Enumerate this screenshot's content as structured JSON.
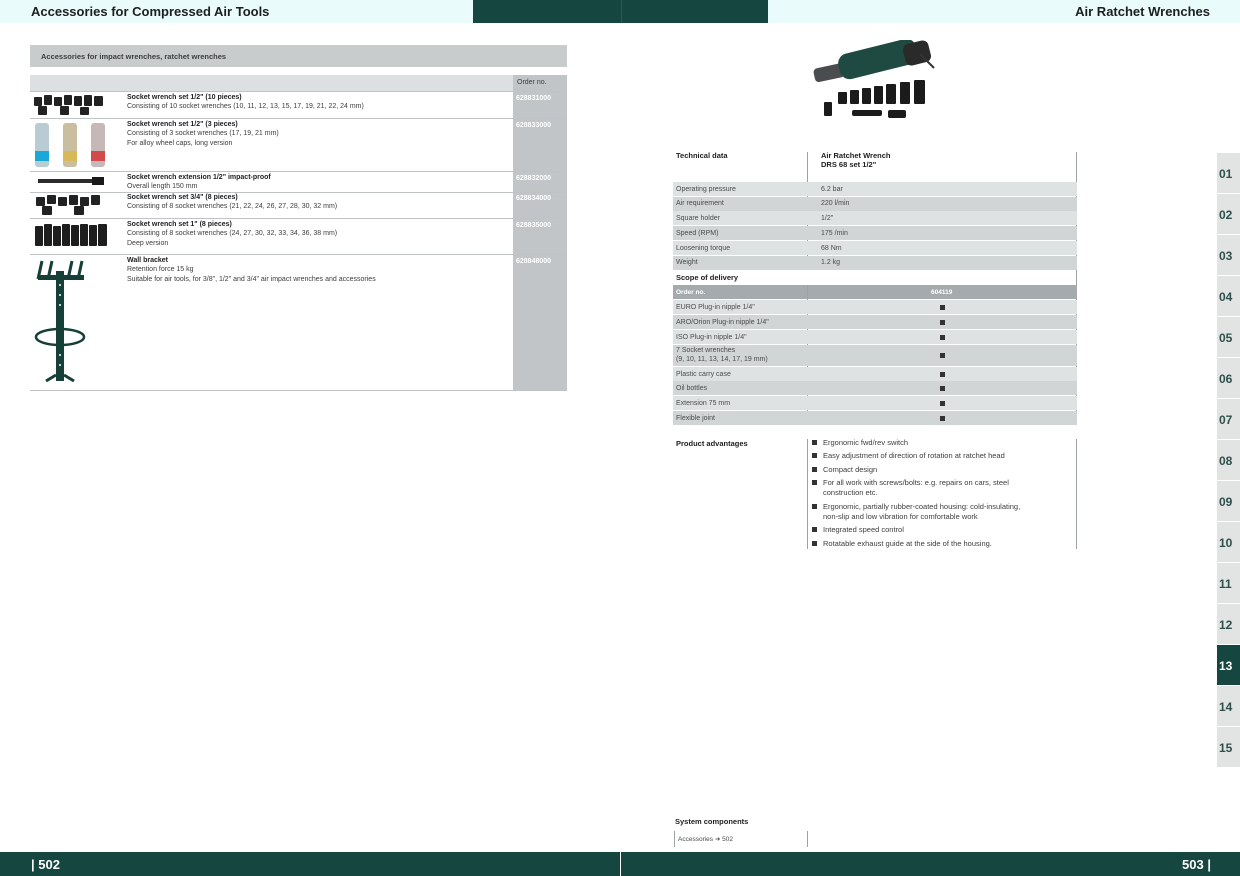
{
  "header": {
    "left_title": "Accessories for Compressed Air Tools",
    "right_title": "Air Ratchet Wrenches"
  },
  "footer": {
    "left_page": "| 502",
    "right_page": "503 |"
  },
  "accessories": {
    "section_title": "Accessories for impact wrenches, ratchet wrenches",
    "order_header": "Order no.",
    "rows": [
      {
        "title": "Socket wrench set 1/2\" (10 pieces)",
        "desc": [
          "Consisting of 10 socket wrenches (10, 11, 12, 13, 15, 17, 19, 21, 22, 24 mm)"
        ],
        "order": "628831000"
      },
      {
        "title": "Socket wrench set 1/2\" (3 pieces)",
        "desc": [
          "Consisting of 3 socket wrenches (17, 19, 21 mm)",
          "For alloy wheel caps, long version"
        ],
        "order": "628833000"
      },
      {
        "title": "Socket wrench extension 1/2\" impact-proof",
        "desc": [
          "Overall length 150 mm"
        ],
        "order": "628832000"
      },
      {
        "title": "Socket wrench set 3/4\" (8 pieces)",
        "desc": [
          "Consisting of 8 socket wrenches (21, 22, 24, 26, 27, 28, 30, 32 mm)"
        ],
        "order": "628834000"
      },
      {
        "title": "Socket wrench set 1\" (8 pieces)",
        "desc": [
          "Consisting of 8 socket wrenches (24, 27, 30, 32, 33, 34, 36, 38 mm)",
          "Deep version"
        ],
        "order": "628835000"
      },
      {
        "title": "Wall bracket",
        "desc": [
          "Retention force 15 kg",
          "Suitable for air tools, for 3/8\", 1/2\" and 3/4\" air impact wrenches and accessories"
        ],
        "order": "628848000"
      }
    ]
  },
  "technical": {
    "heading": "Technical data",
    "product_line1": "Air Ratchet Wrench",
    "product_line2": "DRS 68 set 1/2\"",
    "specs": [
      {
        "label": "Operating pressure",
        "value": "6.2 bar"
      },
      {
        "label": "Air requirement",
        "value": "220 l/min"
      },
      {
        "label": "Square holder",
        "value": "1/2\""
      },
      {
        "label": "Speed (RPM)",
        "value": "175 /min"
      },
      {
        "label": "Loosening torque",
        "value": "68 Nm"
      },
      {
        "label": "Weight",
        "value": "1.2 kg"
      }
    ]
  },
  "scope": {
    "heading": "Scope of delivery",
    "order_label": "Order no.",
    "order_number": "604119",
    "items": [
      {
        "label": "EURO Plug-in nipple 1/4\""
      },
      {
        "label": "ARO/Orion Plug-in nipple 1/4\""
      },
      {
        "label": "ISO Plug-in nipple 1/4\""
      },
      {
        "label": "7 Socket wrenches",
        "label2": "(9, 10, 11, 13, 14, 17, 19 mm)"
      },
      {
        "label": "Plastic carry case"
      },
      {
        "label": "Oil bottles"
      },
      {
        "label": "Extension 75 mm"
      },
      {
        "label": "Flexible joint"
      }
    ]
  },
  "advantages": {
    "heading": "Product advantages",
    "items": [
      [
        "Ergonomic fwd/rev switch"
      ],
      [
        "Easy adjustment of direction of rotation at ratchet head"
      ],
      [
        "Compact design"
      ],
      [
        "For all work with screws/bolts: e.g. repairs on cars, steel",
        "construction etc."
      ],
      [
        "Ergonomic, partially rubber-coated housing: cold-insulating,",
        "non-slip and low vibration for comfortable work"
      ],
      [
        "Integrated speed control"
      ],
      [
        "Rotatable exhaust guide at the side of the housing."
      ]
    ]
  },
  "system": {
    "heading": "System components",
    "link": "Accessories ➜ 502"
  },
  "tabs": [
    "01",
    "02",
    "03",
    "04",
    "05",
    "06",
    "07",
    "08",
    "09",
    "10",
    "11",
    "12",
    "13",
    "14",
    "15"
  ],
  "active_tab": "13",
  "colors": {
    "dark_green": "#164640",
    "header_light": "#e9fbfb",
    "order_column": "#c1c5c7"
  }
}
